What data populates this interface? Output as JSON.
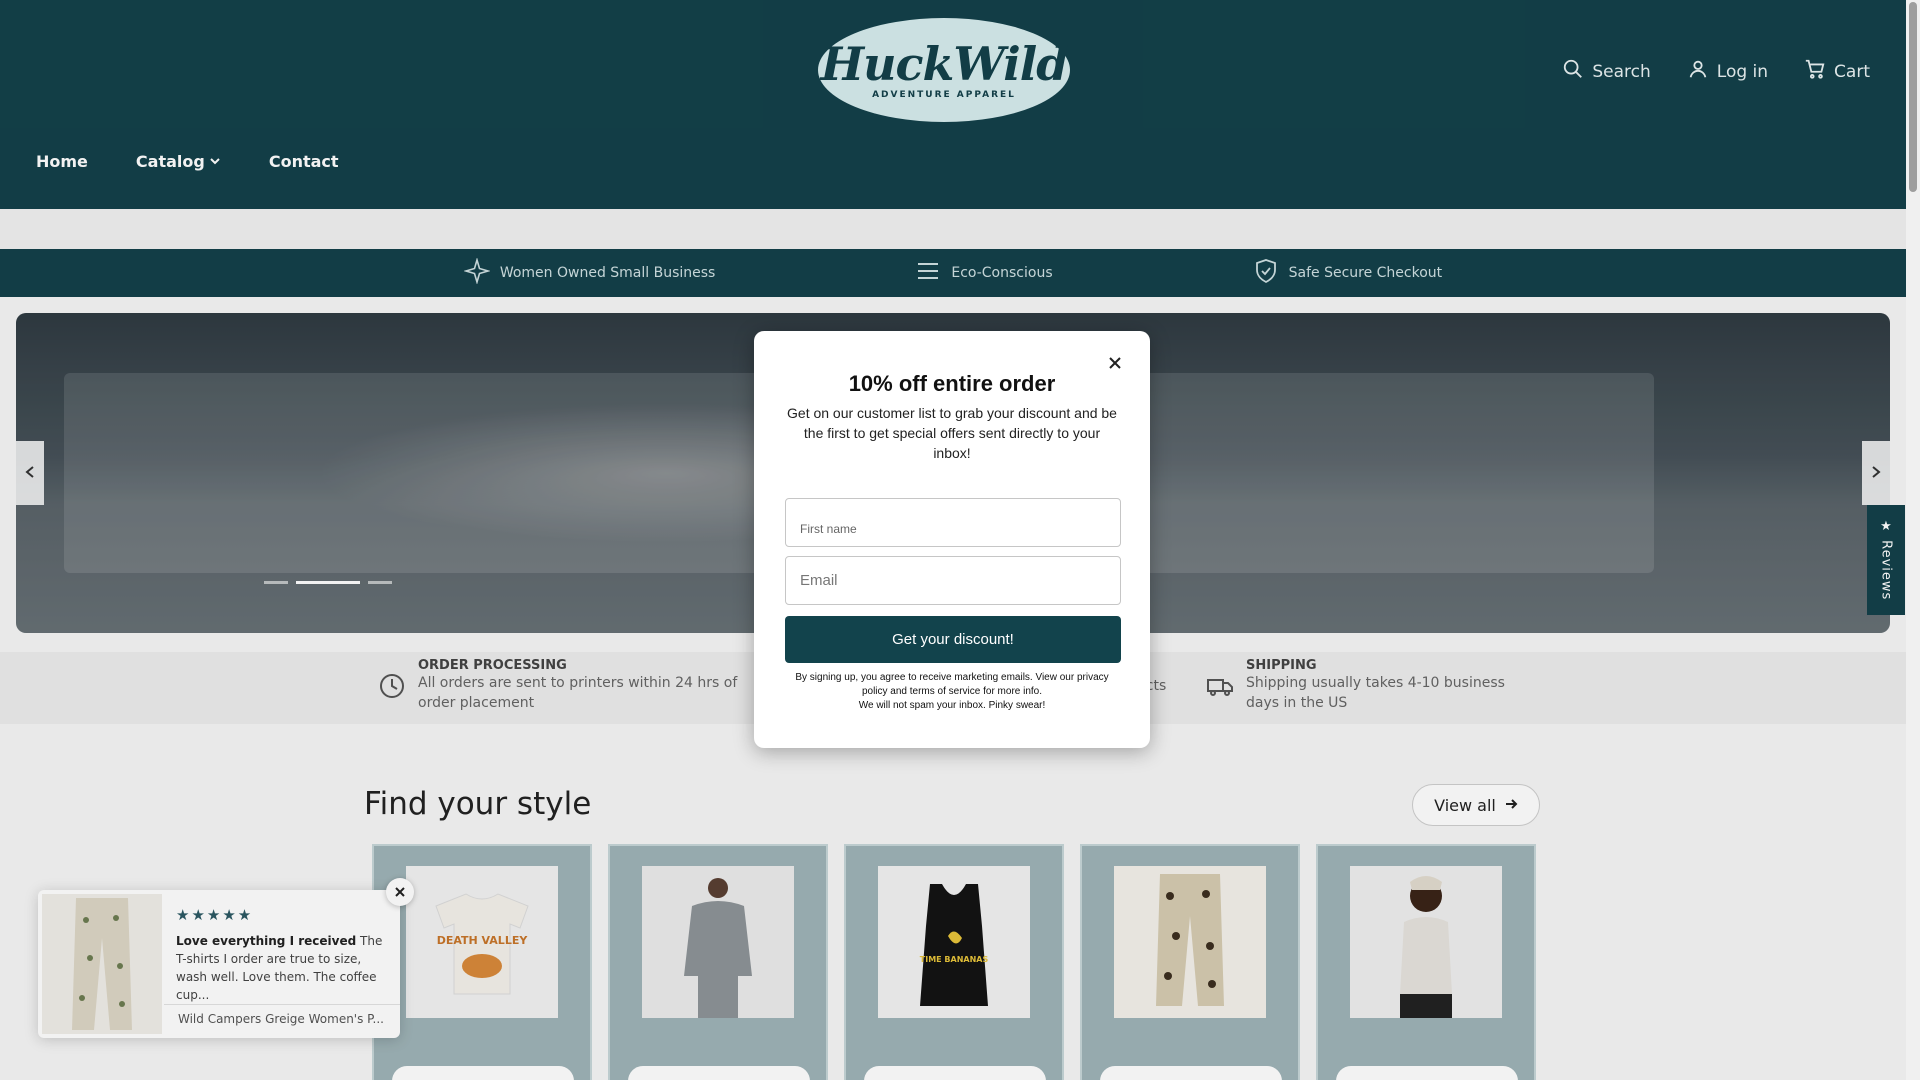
{
  "header": {
    "logo_main": "HuckWild",
    "logo_sub": "ADVENTURE APPAREL",
    "search_label": "Search",
    "login_label": "Log in",
    "cart_label": "Cart"
  },
  "nav": {
    "items": [
      {
        "label": "Home"
      },
      {
        "label": "Catalog"
      },
      {
        "label": "Contact"
      }
    ]
  },
  "infobar": {
    "items": [
      {
        "label": "Women Owned Small Business",
        "icon": "sparkle-icon"
      },
      {
        "label": "Eco-Conscious",
        "icon": "menu-lines-icon"
      },
      {
        "label": "Safe Secure Checkout",
        "icon": "shield-check-icon"
      }
    ]
  },
  "hero": {
    "slides_count": 3,
    "active_slide": 2
  },
  "perks": {
    "order": {
      "title": "ORDER PROCESSING",
      "text": "All orders are sent to printers within 24 hrs of order placement"
    },
    "middle": {
      "text": "ducts"
    },
    "shipping": {
      "title": "SHIPPING",
      "text": "Shipping usually takes 4-10 business days in the US"
    }
  },
  "section": {
    "title": "Find your style",
    "view_all": "View all"
  },
  "cards": [
    {
      "name": "t-shirt",
      "art": "DEATH VALLEY"
    },
    {
      "name": "long-sleeve"
    },
    {
      "name": "tank-top",
      "art": "TIME BANANAS"
    },
    {
      "name": "pants"
    },
    {
      "name": "bodysuit"
    }
  ],
  "modal": {
    "title": "10% off entire order",
    "description": "Get on our customer list to grab your discount and be the first to get special offers sent directly to your inbox!",
    "first_name_placeholder": "First name",
    "email_placeholder": "Email",
    "button": "Get your discount!",
    "legal_line1": "By signing up, you agree to receive marketing emails. View our privacy policy and terms of service for more info.",
    "legal_line2": "We will not spam your inbox. Pinky swear!"
  },
  "reviews_tab": {
    "label": "★ Reviews"
  },
  "review_popup": {
    "stars": "★★★★★",
    "rating": 5,
    "headline": "Love everything I received",
    "body": "The T-shirts I order are true to size, wash well. Love them. The coffee cup...",
    "product": "Wild Campers Greige Women's P..."
  },
  "colors": {
    "brand": "#13414a",
    "logo_bg": "#d6ecee",
    "button": "#12434c"
  }
}
